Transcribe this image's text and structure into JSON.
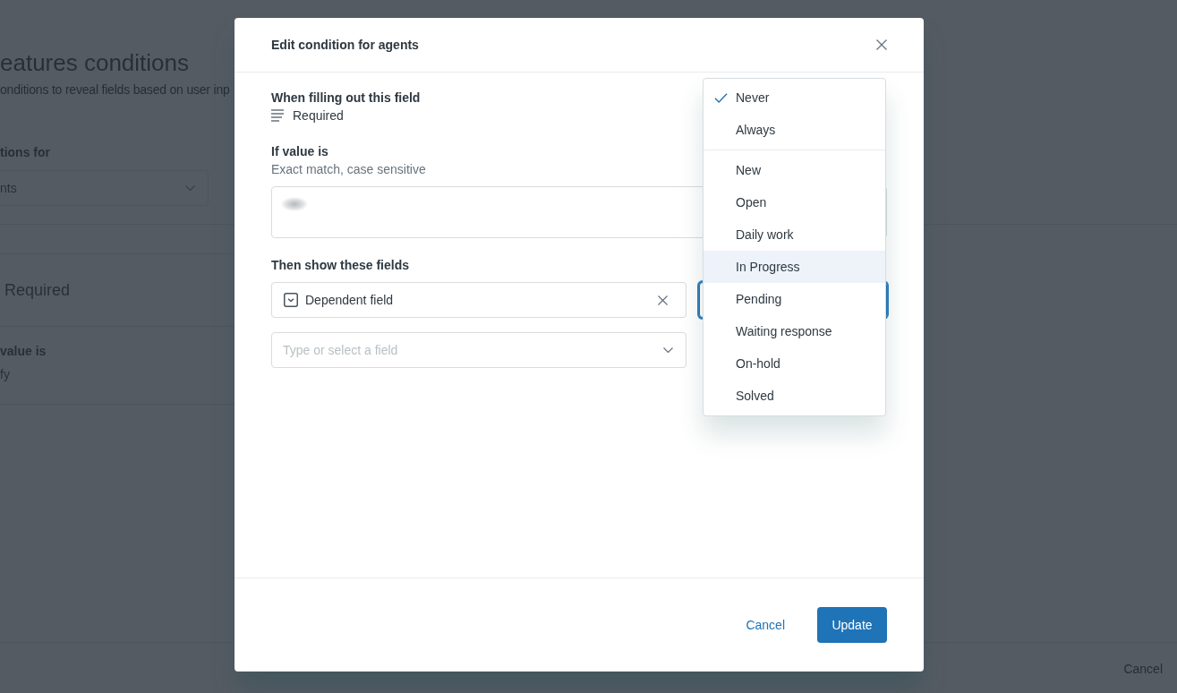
{
  "background_page": {
    "title": "eatures conditions",
    "subtitle": "onditions to reveal fields based on user inp",
    "conditions_for": {
      "label": "tions for",
      "value": "nts"
    },
    "condition": {
      "field": "Required",
      "value_label": "value is",
      "value": "fy"
    },
    "cancel": "Cancel"
  },
  "modal": {
    "title": "Edit condition for agents",
    "field_section": {
      "label": "When filling out this field",
      "field": "Required"
    },
    "value_section": {
      "label": "If value is",
      "hint": "Exact match, case sensitive",
      "value_redacted": true
    },
    "show_section": {
      "label": "Then show these fields",
      "fields": [
        {
          "name": "Dependent field"
        }
      ],
      "add_field": {
        "placeholder": "Type or select a field"
      },
      "condition_select": {
        "open": true,
        "groups": [
          {
            "options": [
              {
                "label": "Never",
                "selected": true,
                "highlighted": false
              },
              {
                "label": "Always",
                "selected": false,
                "highlighted": false
              }
            ]
          },
          {
            "options": [
              {
                "label": "New",
                "selected": false,
                "highlighted": false
              },
              {
                "label": "Open",
                "selected": false,
                "highlighted": false
              },
              {
                "label": "Daily work",
                "selected": false,
                "highlighted": false
              },
              {
                "label": "In Progress",
                "selected": false,
                "highlighted": true
              },
              {
                "label": "Pending",
                "selected": false,
                "highlighted": false
              },
              {
                "label": "Waiting response",
                "selected": false,
                "highlighted": false
              },
              {
                "label": "On-hold",
                "selected": false,
                "highlighted": false
              },
              {
                "label": "Solved",
                "selected": false,
                "highlighted": false
              }
            ]
          }
        ]
      }
    },
    "buttons": {
      "cancel": "Cancel",
      "update": "Update"
    }
  }
}
